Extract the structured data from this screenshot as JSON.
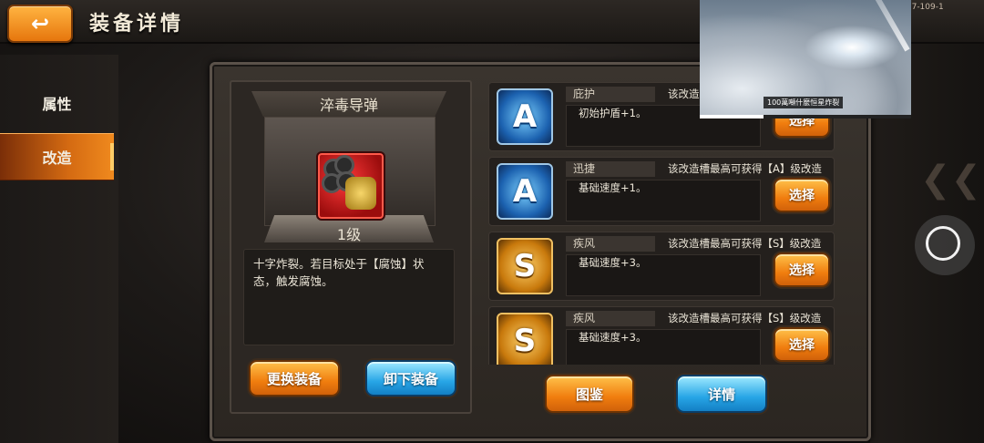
{
  "header": {
    "back_icon": "back-arrow-icon",
    "title": "装备详情",
    "build_tag": "6.7-109-1"
  },
  "tabs": [
    {
      "label": "属性",
      "active": false
    },
    {
      "label": "改造",
      "active": true
    }
  ],
  "item": {
    "name": "淬毒导弹",
    "level": "1级",
    "description": "十字炸裂。若目标处于【腐蚀】状态，触发腐蚀。",
    "icon": "poison-missile-icon"
  },
  "left_buttons": {
    "change": "更换装备",
    "unequip": "卸下装备"
  },
  "slots": [
    {
      "grade": "A",
      "name": "庇护",
      "note": "该改造槽最高可获得【A】级改造",
      "effect": "初始护盾+1。",
      "button": "选择"
    },
    {
      "grade": "A",
      "name": "迅捷",
      "note": "该改造槽最高可获得【A】级改造",
      "effect": "基础速度+1。",
      "button": "选择"
    },
    {
      "grade": "S",
      "name": "疾风",
      "note": "该改造槽最高可获得【S】级改造",
      "effect": "基础速度+3。",
      "button": "选择"
    },
    {
      "grade": "S",
      "name": "疾风",
      "note": "该改造槽最高可获得【S】级改造",
      "effect": "基础速度+3。",
      "button": "选择"
    }
  ],
  "bottom_buttons": {
    "atlas": "图鉴",
    "details": "详情"
  },
  "video_overlay": {
    "caption": "100萬噸什麼恒星炸裂",
    "progress": 0.3
  },
  "colors": {
    "accent_orange": "#f07d0e",
    "accent_blue": "#27a5e6",
    "panel": "#2c2723"
  }
}
